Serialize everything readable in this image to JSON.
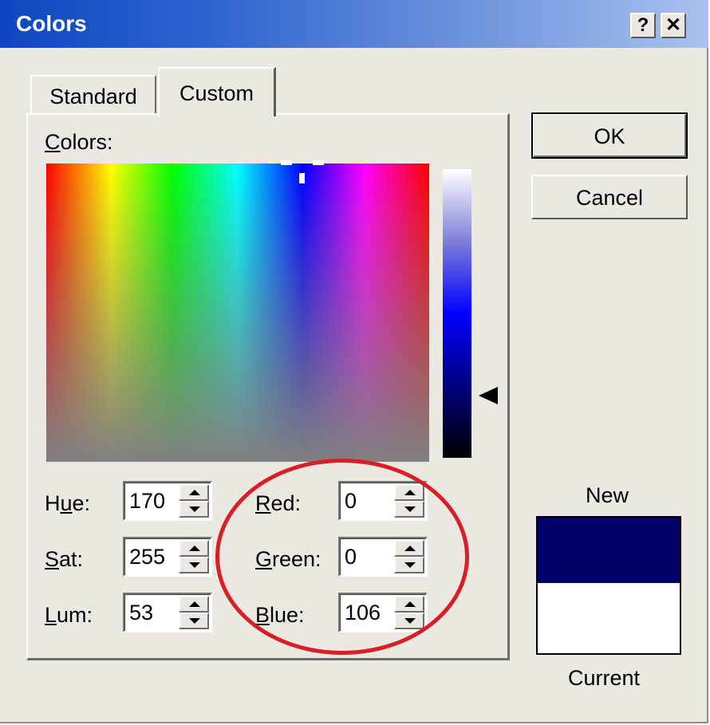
{
  "window": {
    "title": "Colors",
    "help_button": "?",
    "close_button": "✕"
  },
  "tabs": [
    {
      "label": "Standard",
      "selected": false
    },
    {
      "label": "Custom",
      "selected": true
    }
  ],
  "colors_label": {
    "mnemonic": "C",
    "rest": "olors:"
  },
  "fields": {
    "hue": {
      "label_pre": "H",
      "label_mnemonic": "u",
      "label_post": "e:",
      "value": "170"
    },
    "sat": {
      "label_pre": "",
      "label_mnemonic": "S",
      "label_post": "at:",
      "value": "255"
    },
    "lum": {
      "label_pre": "",
      "label_mnemonic": "L",
      "label_post": "um:",
      "value": "53"
    },
    "red": {
      "label_pre": "",
      "label_mnemonic": "R",
      "label_post": "ed:",
      "value": "0"
    },
    "green": {
      "label_pre": "",
      "label_mnemonic": "G",
      "label_post": "reen:",
      "value": "0"
    },
    "blue": {
      "label_pre": "",
      "label_mnemonic": "B",
      "label_post": "lue:",
      "value": "106"
    }
  },
  "buttons": {
    "ok": "OK",
    "cancel": "Cancel"
  },
  "preview": {
    "new_label": "New",
    "current_label": "Current",
    "new_color": "#00006a",
    "current_color": "#ffffff"
  },
  "colors": {
    "annotation_circle": "#d81f28",
    "title_bar": "#0d47c0",
    "dialog_face": "#ebe8e2"
  }
}
